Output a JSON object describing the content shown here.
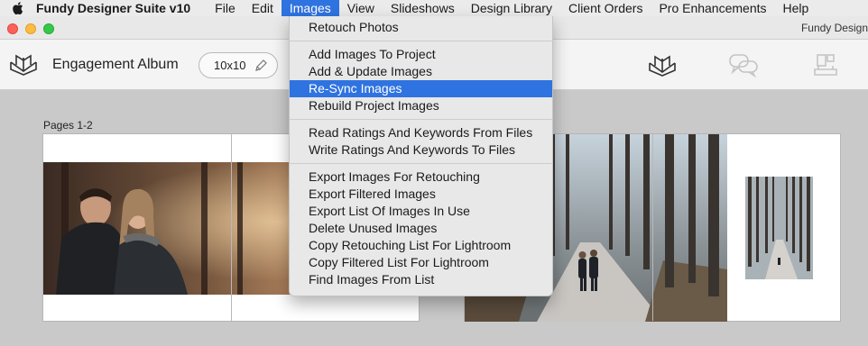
{
  "menubar": {
    "app_name": "Fundy Designer Suite v10",
    "items": [
      "File",
      "Edit",
      "Images",
      "View",
      "Slideshows",
      "Design Library",
      "Client Orders",
      "Pro Enhancements",
      "Help"
    ],
    "active_item": "Images"
  },
  "window": {
    "title": "Fundy Design"
  },
  "toolbar": {
    "album_title": "Engagement Album",
    "album_size": "10x10"
  },
  "workspace": {
    "pages_label": "Pages 1-2"
  },
  "images_menu": {
    "group1": [
      "Retouch Photos"
    ],
    "group2": [
      "Add Images To Project",
      "Add & Update Images",
      "Re-Sync Images",
      "Rebuild Project Images"
    ],
    "group3": [
      "Read Ratings And Keywords From Files",
      "Write Ratings And Keywords To Files"
    ],
    "group4": [
      "Export Images For Retouching",
      "Export Filtered Images",
      "Export List Of Images In Use",
      "Delete Unused Images",
      "Copy Retouching List For Lightroom",
      "Copy Filtered List For Lightroom",
      "Find Images From List"
    ],
    "highlighted": "Re-Sync Images"
  },
  "colors": {
    "highlight": "#2f73e0",
    "menu_bg": "#e8e8e8",
    "workspace_bg": "#c9c9c9"
  },
  "icons": [
    "apple-icon",
    "album-book-icon",
    "pencil-icon",
    "design-book-icon",
    "chat-bubbles-icon",
    "layout-icon"
  ]
}
